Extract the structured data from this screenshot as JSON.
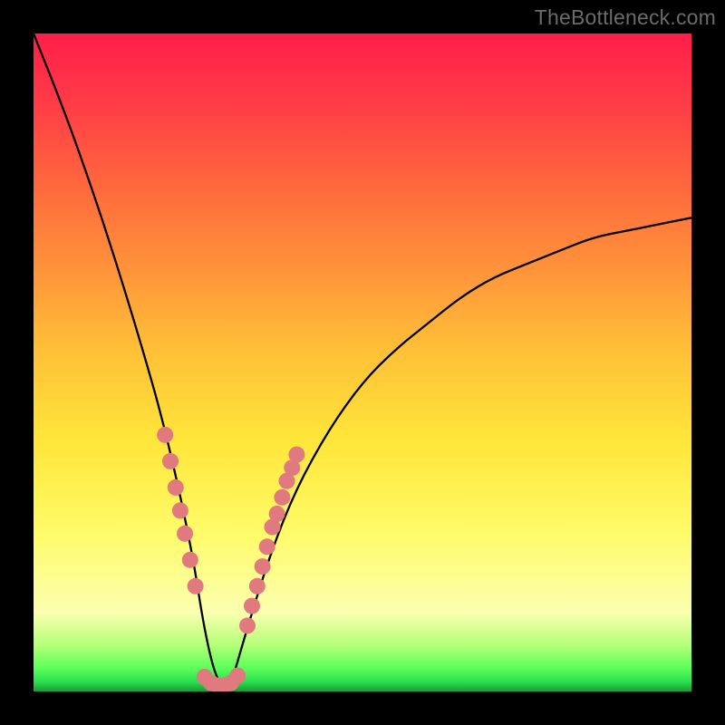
{
  "watermark": "TheBottleneck.com",
  "chart_data": {
    "type": "line",
    "title": "",
    "xlabel": "",
    "ylabel": "",
    "xlim": [
      0,
      100
    ],
    "ylim": [
      0,
      100
    ],
    "curve": {
      "name": "bottleneck-curve",
      "description": "V-shaped curve; high on left, dips to ~0 near x≈28, rises asymptotically toward ~72 on right",
      "x": [
        0,
        4,
        8,
        12,
        16,
        20,
        24,
        26,
        28,
        30,
        32,
        36,
        40,
        45,
        50,
        55,
        60,
        65,
        70,
        75,
        80,
        85,
        90,
        95,
        100
      ],
      "y": [
        100,
        90,
        79,
        67,
        54,
        40,
        22,
        9,
        1,
        1,
        8,
        21,
        31,
        40,
        47,
        52,
        56,
        60,
        63,
        65,
        67,
        69,
        70,
        71,
        72
      ]
    },
    "markers": {
      "name": "data-points",
      "color": "#e07a7f",
      "radius": 9,
      "points": [
        {
          "x": 20.0,
          "y": 39
        },
        {
          "x": 20.8,
          "y": 35
        },
        {
          "x": 21.6,
          "y": 31
        },
        {
          "x": 22.3,
          "y": 27.5
        },
        {
          "x": 23.0,
          "y": 24
        },
        {
          "x": 23.8,
          "y": 20
        },
        {
          "x": 24.6,
          "y": 16
        },
        {
          "x": 26.0,
          "y": 2.2
        },
        {
          "x": 27.0,
          "y": 1.3
        },
        {
          "x": 28.0,
          "y": 0.9
        },
        {
          "x": 29.0,
          "y": 0.9
        },
        {
          "x": 30.0,
          "y": 1.3
        },
        {
          "x": 31.0,
          "y": 2.4
        },
        {
          "x": 32.5,
          "y": 10
        },
        {
          "x": 33.2,
          "y": 13
        },
        {
          "x": 34.0,
          "y": 16
        },
        {
          "x": 34.8,
          "y": 19
        },
        {
          "x": 35.5,
          "y": 22
        },
        {
          "x": 36.3,
          "y": 25
        },
        {
          "x": 37.0,
          "y": 27
        },
        {
          "x": 37.8,
          "y": 29.5
        },
        {
          "x": 38.5,
          "y": 32
        },
        {
          "x": 39.3,
          "y": 34
        },
        {
          "x": 40.0,
          "y": 36
        }
      ]
    }
  }
}
